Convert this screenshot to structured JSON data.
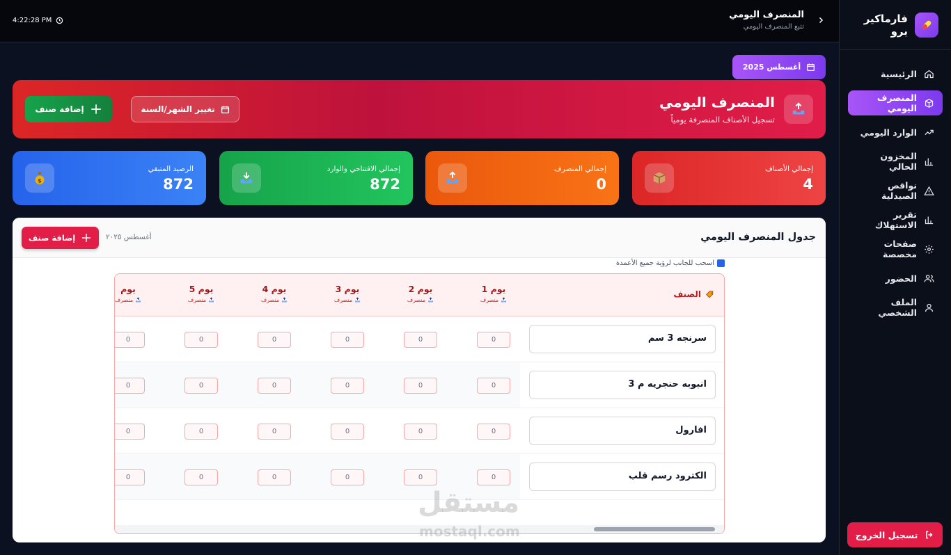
{
  "app": {
    "name": "فارماكير برو"
  },
  "nav": {
    "items": [
      {
        "label": "الرئيسية",
        "icon": "home-icon",
        "active": false
      },
      {
        "label": "المنصرف اليومي",
        "icon": "box-icon",
        "active": true
      },
      {
        "label": "الوارد اليومي",
        "icon": "trending-up-icon",
        "active": false
      },
      {
        "label": "المخزون الحالي",
        "icon": "bar-chart-icon",
        "active": false
      },
      {
        "label": "نواقص الصيدلية",
        "icon": "warning-icon",
        "active": false
      },
      {
        "label": "تقرير الاستهلاك",
        "icon": "bar-chart-icon",
        "active": false
      },
      {
        "label": "صفحات مخصصة",
        "icon": "gear-icon",
        "active": false
      },
      {
        "label": "الحضور",
        "icon": "users-icon",
        "active": false
      },
      {
        "label": "الملف الشخصي",
        "icon": "user-icon",
        "active": false
      }
    ],
    "logout": "تسجيل الخروج"
  },
  "topbar": {
    "clock": "4:22:28 PM",
    "title": "المنصرف اليومي",
    "subtitle": "تتبع المنصرف اليومي"
  },
  "month_pill": "أغسطس 2025",
  "hero": {
    "title": "المنصرف اليومي",
    "subtitle": "تسجيل الأصناف المنصرفة يومياً",
    "change_button": "تغيير الشهر/السنة",
    "add_button": "إضافة صنف"
  },
  "stats": [
    {
      "label": "إجمالي الأصناف",
      "value": "4",
      "color": "#ef4444",
      "icon": "box-icon"
    },
    {
      "label": "إجمالي المنصرف",
      "value": "0",
      "color": "#f97316",
      "icon": "outbox-icon"
    },
    {
      "label": "إجمالي الافتتاحي والوارد",
      "value": "872",
      "color": "#22c55e",
      "icon": "inbox-icon"
    },
    {
      "label": "الرصيد المتبقي",
      "value": "872",
      "color": "#3b82f6",
      "icon": "money-bag-icon"
    }
  ],
  "table": {
    "title": "جدول المنصرف اليومي",
    "month": "أغسطس ٢٠٢٥",
    "add_button": "إضافة صنف",
    "hint": "اسحب للجانب لرؤية جميع الأعمدة",
    "item_header": "الصنف",
    "days": [
      {
        "label": "يوم 1",
        "sub": "منصرف"
      },
      {
        "label": "يوم 2",
        "sub": "منصرف"
      },
      {
        "label": "يوم 3",
        "sub": "منصرف"
      },
      {
        "label": "يوم 4",
        "sub": "منصرف"
      },
      {
        "label": "يوم 5",
        "sub": "منصرف"
      },
      {
        "label": "يوم",
        "sub": "منصرف"
      }
    ],
    "rows": [
      {
        "name": "سرنجه 3 سم",
        "values": [
          "0",
          "0",
          "0",
          "0",
          "0",
          "0"
        ]
      },
      {
        "name": "انبوبه حنجريه م 3",
        "values": [
          "0",
          "0",
          "0",
          "0",
          "0",
          "0"
        ]
      },
      {
        "name": "افارول",
        "values": [
          "0",
          "0",
          "0",
          "0",
          "0",
          "0"
        ]
      },
      {
        "name": "الكترود رسم قلب",
        "values": [
          "0",
          "0",
          "0",
          "0",
          "0",
          "0"
        ]
      }
    ]
  },
  "watermark": {
    "ar": "مستقل",
    "en": "mostaql.com"
  }
}
